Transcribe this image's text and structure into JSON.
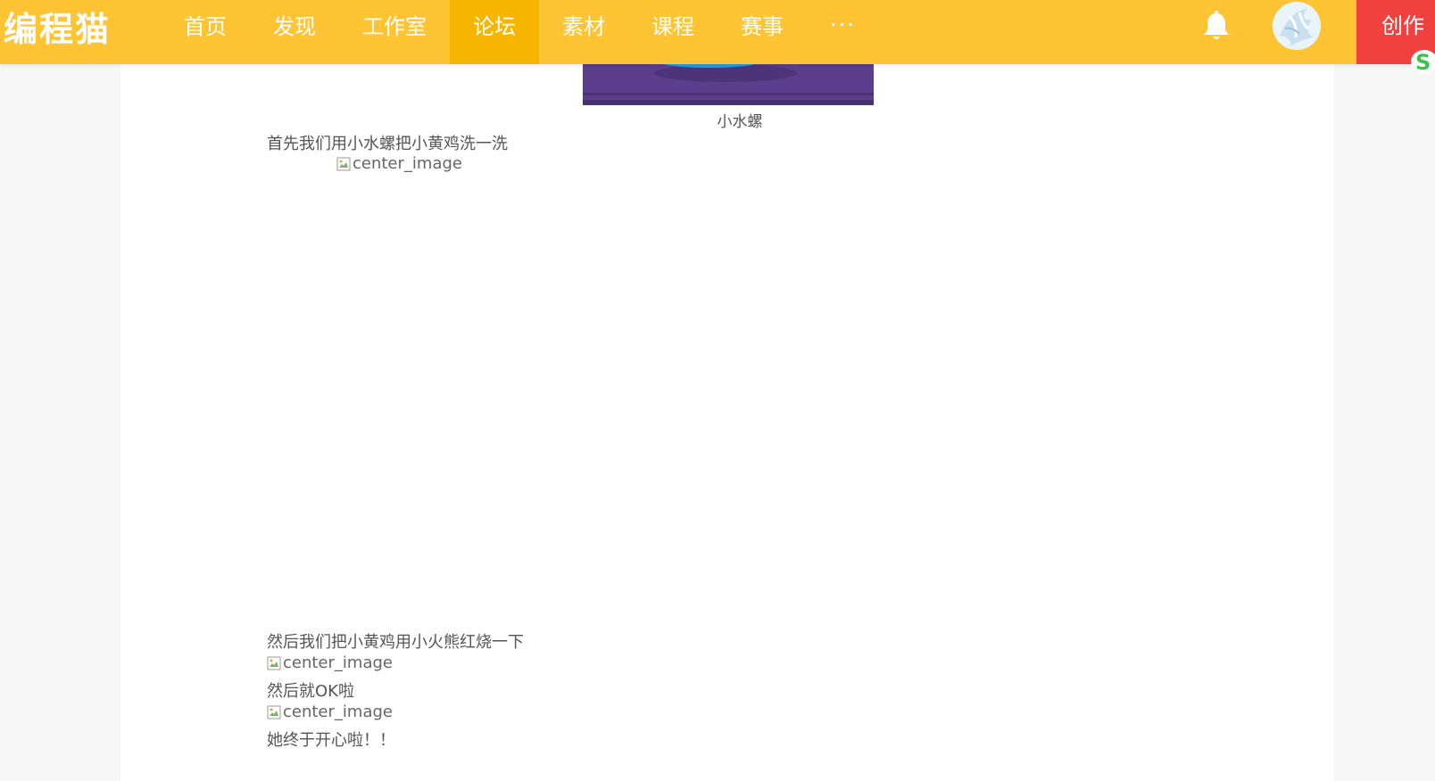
{
  "header": {
    "logo_text": "编程猫",
    "nav": [
      {
        "label": "首页",
        "active": false
      },
      {
        "label": "发现",
        "active": false
      },
      {
        "label": "工作室",
        "active": false
      },
      {
        "label": "论坛",
        "active": true
      },
      {
        "label": "素材",
        "active": false
      },
      {
        "label": "课程",
        "active": false
      },
      {
        "label": "赛事",
        "active": false
      }
    ],
    "more_label": "···",
    "notification_icon": "bell-icon",
    "create_label": "创作",
    "colors": {
      "bar": "#fec433",
      "active_tab": "#f7b500",
      "create_button": "#f0413f",
      "badge": "#3cc34a"
    }
  },
  "article": {
    "hero_caption": "小水螺",
    "paragraphs": [
      "首先我们用小水螺把小黄鸡洗一洗",
      "然后我们把小黄鸡用小火熊红烧一下",
      "然后就OK啦",
      "她终于开心啦！！"
    ],
    "image_alt": "center_image"
  }
}
